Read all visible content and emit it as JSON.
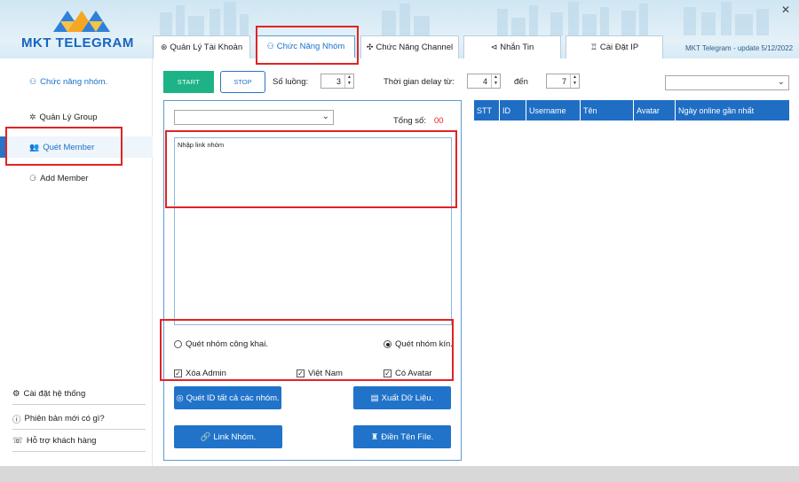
{
  "app": {
    "brand": "MKT TELEGRAM",
    "close_icon": "close-icon",
    "update_text": "MKT Telegram - update 5/12/2022"
  },
  "tabs": [
    {
      "label": "Quản Lý Tài Khoản",
      "icon": "account-icon",
      "active": false
    },
    {
      "label": "Chức Năng Nhóm",
      "icon": "group-icon",
      "active": true
    },
    {
      "label": "Chức Năng Channel",
      "icon": "channel-icon",
      "active": false
    },
    {
      "label": "Nhắn Tin",
      "icon": "send-icon",
      "active": false
    },
    {
      "label": "Cài Đặt IP",
      "icon": "network-icon",
      "active": false
    }
  ],
  "sidebar": {
    "title": "Chức năng nhóm.",
    "items": [
      {
        "label": "Quản Lý Group",
        "icon": "group-manage-icon"
      },
      {
        "label": "Quét Member",
        "icon": "members-icon",
        "active": true
      },
      {
        "label": "Add Member",
        "icon": "add-user-icon"
      }
    ],
    "bottom": [
      {
        "label": "Cài đặt hệ thống",
        "icon": "gear-icon"
      },
      {
        "label": "Phiên bản mới có gì?",
        "icon": "info-icon"
      },
      {
        "label": "Hỗ trợ khách hàng",
        "icon": "support-icon"
      }
    ]
  },
  "toolbar": {
    "start_label": "START",
    "stop_label": "STOP",
    "quantity_label": "Số luồng:",
    "quantity_value": "3",
    "delay_label": "Thời gian delay từ:",
    "delay_from": "4",
    "delay_to_label": "đến",
    "delay_to": "7",
    "right_select_value": ""
  },
  "panel": {
    "group_select_value": "",
    "total_label": "Tổng số:",
    "total_value": "00",
    "link_input_text": "Nhập link nhóm",
    "radio_public": {
      "label": "Quét nhóm công khai.",
      "checked": false
    },
    "radio_private": {
      "label": "Quét nhóm kín.",
      "checked": true
    },
    "check_remove_admin": {
      "label": "Xóa Admin",
      "checked": true
    },
    "check_vietnam": {
      "label": "Việt Nam",
      "checked": true
    },
    "check_avatar": {
      "label": "Có Avatar",
      "checked": true
    },
    "btn_scan_all": "Quét ID tất cả các nhóm.",
    "btn_export": "Xuất Dữ Liệu.",
    "btn_link": "Link Nhóm.",
    "btn_filename": "Điền Tên File."
  },
  "table": {
    "columns": [
      "STT",
      "ID",
      "Username",
      "Tên",
      "Avatar",
      "Ngày online gần nhất"
    ],
    "rows": []
  },
  "colors": {
    "accent": "#1f6ec4",
    "start_green": "#1db386",
    "highlight_red": "#e02424"
  }
}
